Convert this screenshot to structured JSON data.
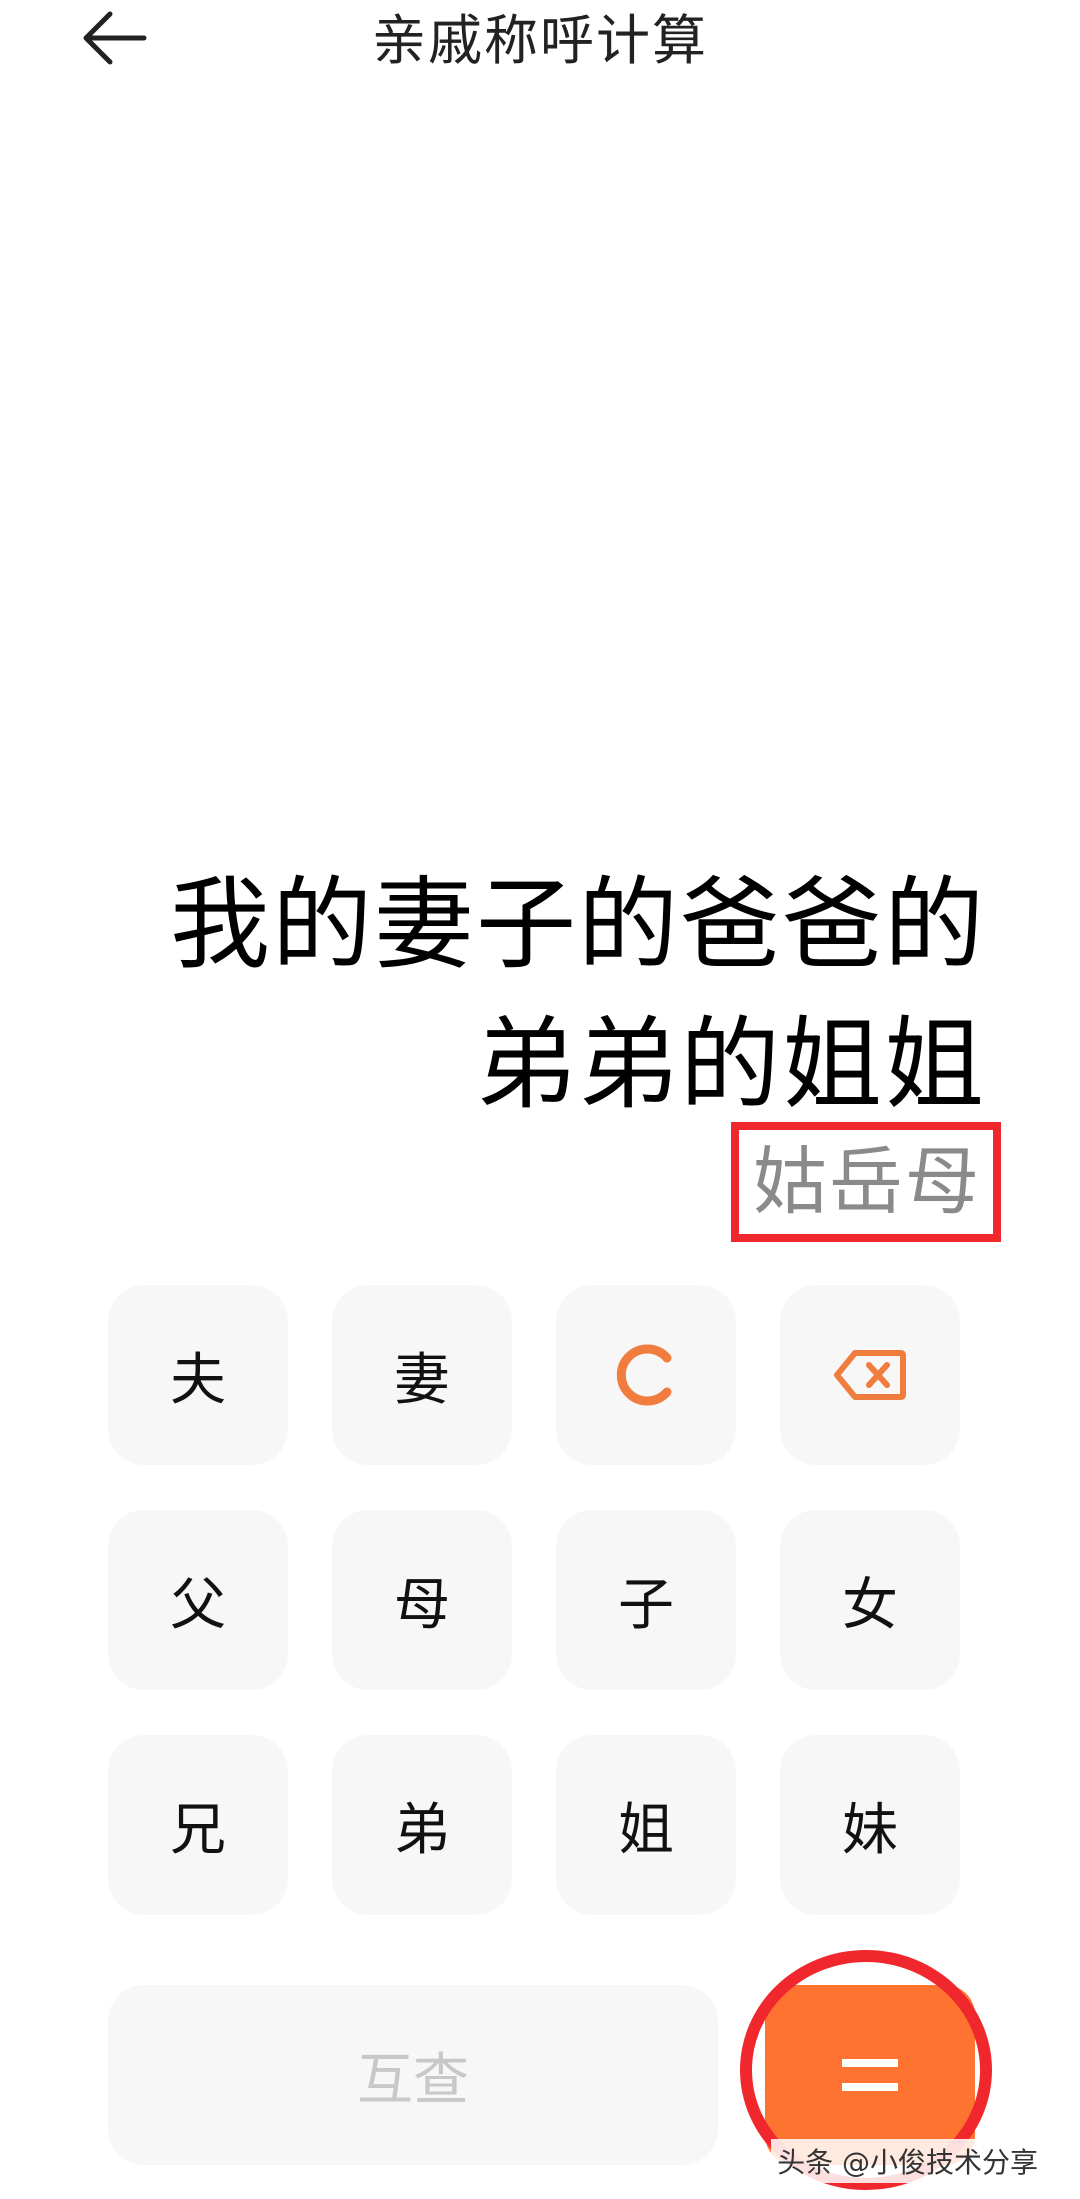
{
  "header": {
    "title": "亲戚称呼计算",
    "back_icon": "arrow-left-icon"
  },
  "display": {
    "expression_line1": "我的妻子的爸爸的",
    "expression_line2": "弟弟的姐姐",
    "result": "姑岳母"
  },
  "keypad": {
    "row1": [
      "夫",
      "妻",
      "C",
      "backspace-icon"
    ],
    "row2": [
      "父",
      "母",
      "子",
      "女"
    ],
    "row3": [
      "兄",
      "弟",
      "姐",
      "妹"
    ],
    "mutual_label": "互查",
    "equals_label": "="
  },
  "colors": {
    "accent": "#f07c3e",
    "equals_bg": "#ff7330",
    "highlight": "#f0282d",
    "key_bg": "#f7f7f7"
  },
  "watermark": "头条 @小俊技术分享"
}
